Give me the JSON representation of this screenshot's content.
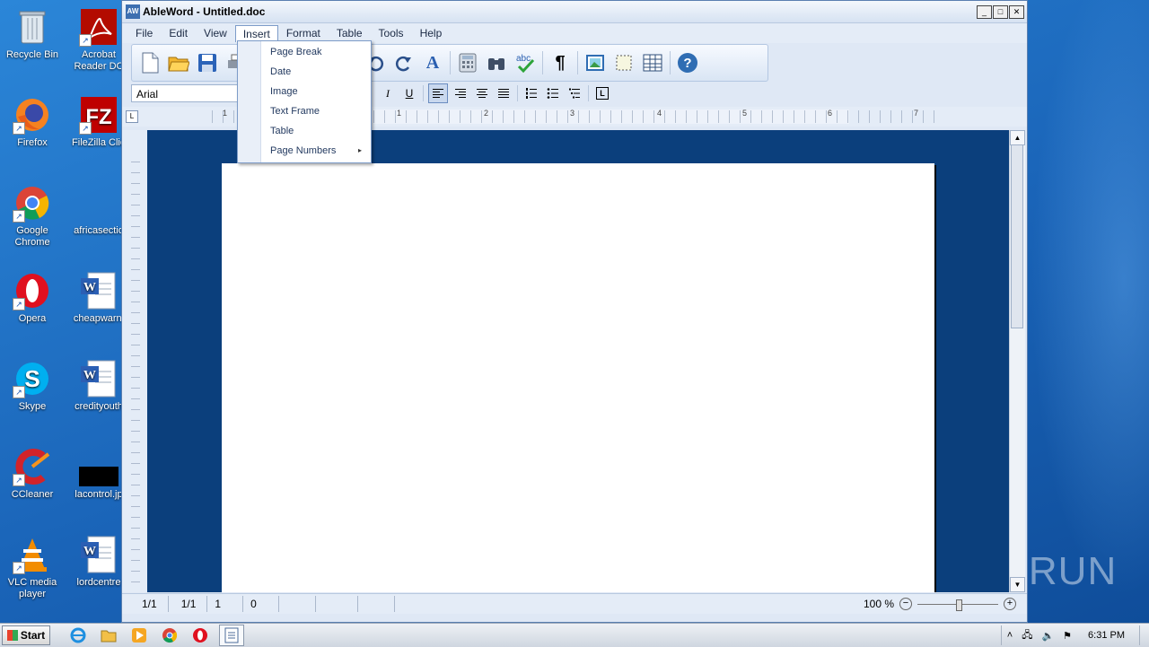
{
  "desktop": {
    "icons_col1": [
      {
        "label": "Recycle Bin",
        "icon": "recycle-bin-icon"
      },
      {
        "label": "Firefox",
        "icon": "firefox-icon"
      },
      {
        "label": "Google Chrome",
        "icon": "chrome-icon"
      },
      {
        "label": "Opera",
        "icon": "opera-icon"
      },
      {
        "label": "Skype",
        "icon": "skype-icon"
      },
      {
        "label": "CCleaner",
        "icon": "ccleaner-icon"
      },
      {
        "label": "VLC media player",
        "icon": "vlc-icon"
      }
    ],
    "icons_col2": [
      {
        "label": "Acrobat Reader DC",
        "icon": "acrobat-icon"
      },
      {
        "label": "FileZilla Clie",
        "icon": "filezilla-icon"
      },
      {
        "label": "africasectio",
        "icon": "blank-file-icon"
      },
      {
        "label": "cheapwarni",
        "icon": "word-doc-icon"
      },
      {
        "label": "credityouth",
        "icon": "word-doc-icon"
      },
      {
        "label": "lacontrol.jp",
        "icon": "image-file-icon"
      },
      {
        "label": "lordcentre",
        "icon": "word-doc-icon"
      }
    ],
    "watermark": "ANY RUN"
  },
  "window": {
    "app_badge": "AW",
    "title": "AbleWord - Untitled.doc",
    "controls": {
      "minimize": "_",
      "maximize": "□",
      "close": "✕"
    }
  },
  "menubar": [
    "File",
    "Edit",
    "View",
    "Insert",
    "Format",
    "Table",
    "Tools",
    "Help"
  ],
  "active_menu": "Insert",
  "insert_menu": {
    "items": [
      "Page Break",
      "Date",
      "Image",
      "Text Frame",
      "Table",
      "Page Numbers"
    ],
    "submenu_arrow": "▸"
  },
  "toolbar": {
    "icons": [
      "new-document-icon",
      "open-folder-icon",
      "save-icon",
      "print-icon",
      "paste-icon",
      "undo-icon",
      "redo-icon",
      "font-icon",
      "calculator-icon",
      "find-binoculars-icon",
      "spellcheck-icon",
      "pilcrow-icon",
      "insert-image-icon",
      "frame-icon",
      "table-icon",
      "help-icon"
    ],
    "glyphs": {
      "new": "🗋",
      "open": "📂",
      "save": "💾",
      "print": "🖶",
      "paste": "📋",
      "undo": "↶",
      "redo": "↷",
      "font": "A",
      "calc": "▦",
      "find": "⚲",
      "spell": "✔",
      "pilcrow": "¶",
      "image": "▣",
      "frame": "⬚",
      "table": "▦",
      "help": "?"
    }
  },
  "format_bar": {
    "font_name": "Arial",
    "italic": "I",
    "underline": "U",
    "align_icons": [
      "≡",
      "≡",
      "≡",
      "≡"
    ],
    "list_icons": [
      "☰",
      "☰",
      "☰"
    ],
    "tab_icon": "L"
  },
  "ruler": {
    "numbers": [
      "1",
      "1",
      "2",
      "3",
      "4",
      "5",
      "6",
      "7"
    ],
    "corner": "L"
  },
  "scrollbar": {
    "up": "▲",
    "down": "▼"
  },
  "statusbar": {
    "page": "1/1",
    "section": "1/1",
    "line": "1",
    "column": "0",
    "zoom": "100 %",
    "zoom_out": "−",
    "zoom_in": "+",
    "zoom_level": 0.5
  },
  "taskbar": {
    "start_label": "Start",
    "apps": [
      "ie-icon",
      "explorer-icon",
      "media-player-icon",
      "chrome-icon",
      "opera-icon",
      "ableword-icon"
    ],
    "glyphs": {
      "ie": "ℯ",
      "explorer": "🗀",
      "media": "▶",
      "chrome": "◉",
      "opera": "O",
      "ableword": "▤"
    },
    "tray": {
      "expand": "˄",
      "network": "🖧",
      "volume": "🔈",
      "flag": "⚑"
    },
    "clock": "6:31 PM"
  }
}
